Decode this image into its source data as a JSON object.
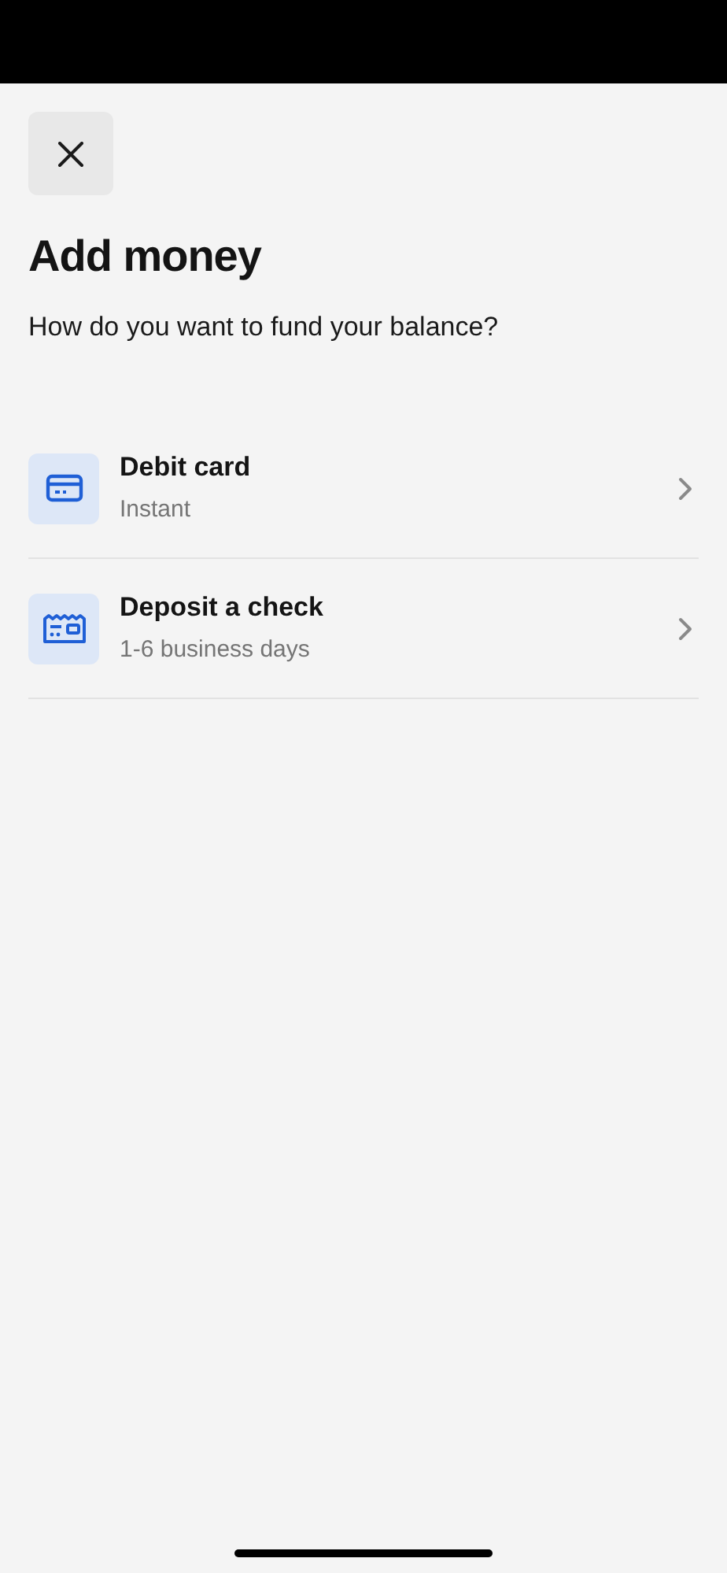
{
  "header": {
    "title": "Add money",
    "subtitle": "How do you want to fund your balance?"
  },
  "options": [
    {
      "kind": "card",
      "label": "Debit card",
      "detail": "Instant"
    },
    {
      "kind": "check",
      "label": "Deposit a check",
      "detail": "1-6 business days"
    }
  ]
}
